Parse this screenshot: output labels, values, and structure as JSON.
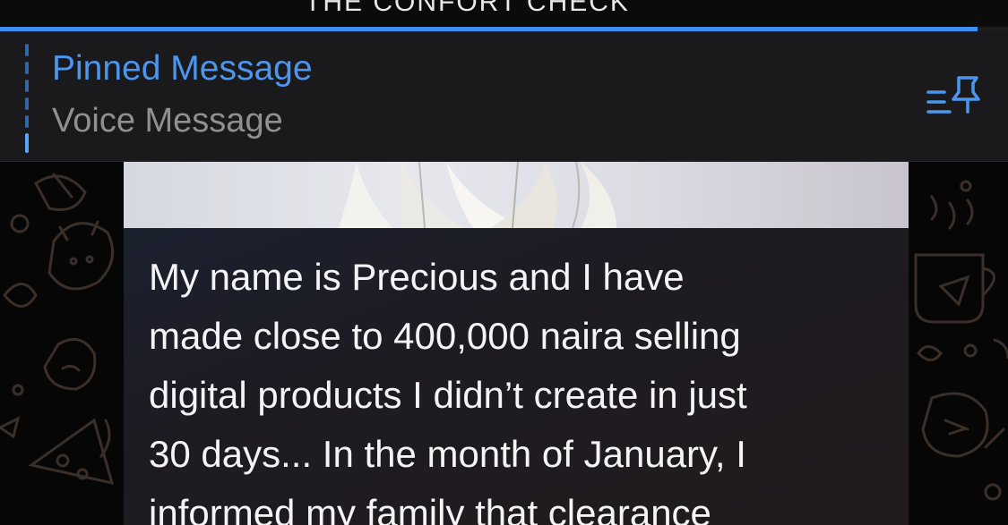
{
  "header": {
    "title_partial": "THE CONFORT CHECK"
  },
  "pinned": {
    "title": "Pinned Message",
    "subtitle": "Voice Message",
    "icon": "pin-list-icon",
    "progress_fraction": 0.97
  },
  "message": {
    "text": "My name is Precious and I have\nmade close to 400,000 naira selling\ndigital products I didn’t create in just\n30 days... In the month of January, I\ninformed my family that clearance"
  },
  "colors": {
    "accent": "#4b96ee",
    "pinned_bar_bg": "#1a1a1c",
    "subtitle": "#8f8f94",
    "bubble_text": "#f4f4f6"
  }
}
